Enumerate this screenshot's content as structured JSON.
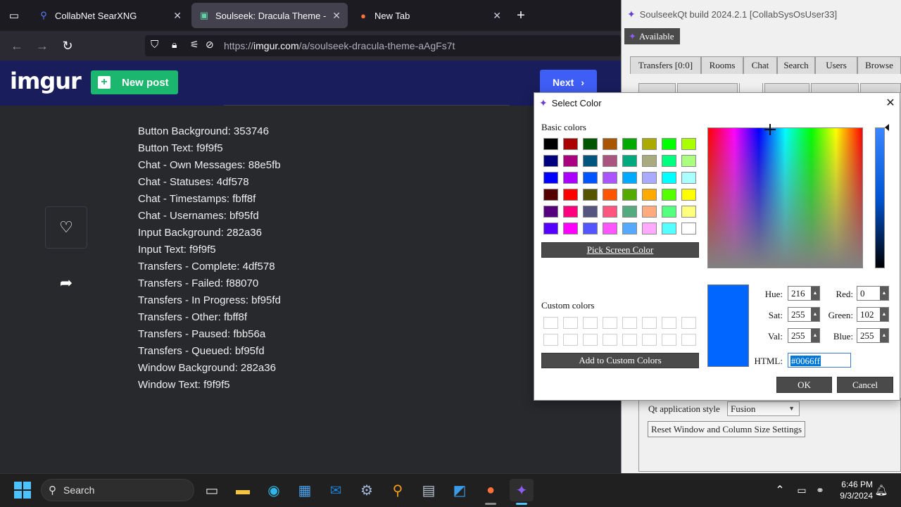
{
  "browser": {
    "tabs": [
      {
        "label": "CollabNet SearXNG",
        "active": false
      },
      {
        "label": "Soulseek: Dracula Theme - Imgur",
        "active": true
      },
      {
        "label": "New Tab",
        "active": false
      }
    ],
    "url_prefix": "https://",
    "url_host": "imgur.com",
    "url_path": "/a/soulseek-dracula-theme-aAgFs7t"
  },
  "imgur": {
    "logo": "imgur",
    "new_post": "New post",
    "next": "Next",
    "description": [
      "Button Background: 353746",
      "Button Text: f9f9f5",
      "Chat - Own Messages: 88e5fb",
      "Chat - Statuses: 4df578",
      "Chat - Timestamps: fbff8f",
      "Chat - Usernames: bf95fd",
      "Input Background: 282a36",
      "Input Text: f9f9f5",
      "Transfers - Complete: 4df578",
      "Transfers - Failed: f88070",
      "Transfers - In Progress: bf95fd",
      "Transfers - Other: fbff8f",
      "Transfers - Paused: fbb56a",
      "Transfers - Queued: bf95fd",
      "Window Background: 282a36",
      "Window Text: f9f9f5"
    ]
  },
  "soulseek": {
    "title": "SoulseekQt build 2024.2.1 [CollabSysOsUser33]",
    "status": "Available",
    "tabs": [
      "Transfers [0:0]",
      "Rooms",
      "Chat",
      "Search",
      "Users",
      "Browse"
    ],
    "style_label": "Qt application style",
    "style_value": "Fusion",
    "reset_button": "Reset Window and Column Size Settings"
  },
  "dialog": {
    "title": "Select Color",
    "basic_colors_label": "Basic colors",
    "basic_colors": [
      "#000000",
      "#aa0000",
      "#005500",
      "#aa5500",
      "#00aa00",
      "#aaaa00",
      "#00ff00",
      "#aaff00",
      "#00007f",
      "#aa007f",
      "#00557f",
      "#aa557f",
      "#00aa7f",
      "#aaaa7f",
      "#00ff7f",
      "#aaff7f",
      "#0000ff",
      "#aa00ff",
      "#0055ff",
      "#aa55ff",
      "#00aaff",
      "#aaaaff",
      "#00ffff",
      "#aaffff",
      "#550000",
      "#ff0000",
      "#555500",
      "#ff5500",
      "#55aa00",
      "#ffaa00",
      "#55ff00",
      "#ffff00",
      "#55007f",
      "#ff007f",
      "#55557f",
      "#ff557f",
      "#55aa7f",
      "#ffaa7f",
      "#55ff7f",
      "#ffff7f",
      "#5500ff",
      "#ff00ff",
      "#5555ff",
      "#ff55ff",
      "#55aaff",
      "#ffaaff",
      "#55ffff",
      "#ffffff"
    ],
    "pick_screen": "Pick Screen Color",
    "custom_colors_label": "Custom colors",
    "add_custom": "Add to Custom Colors",
    "fields": {
      "hue_label": "Hue:",
      "hue": "216",
      "sat_label": "Sat:",
      "sat": "255",
      "val_label": "Val:",
      "val": "255",
      "red_label": "Red:",
      "red": "0",
      "green_label": "Green:",
      "green": "102",
      "blue_label": "Blue:",
      "blue": "255",
      "html_label": "HTML:",
      "html": "#0066ff"
    },
    "current_color": "#0066ff",
    "ok": "OK",
    "cancel": "Cancel"
  },
  "taskbar": {
    "search_placeholder": "Search",
    "time": "6:46 PM",
    "date": "9/3/2024"
  }
}
